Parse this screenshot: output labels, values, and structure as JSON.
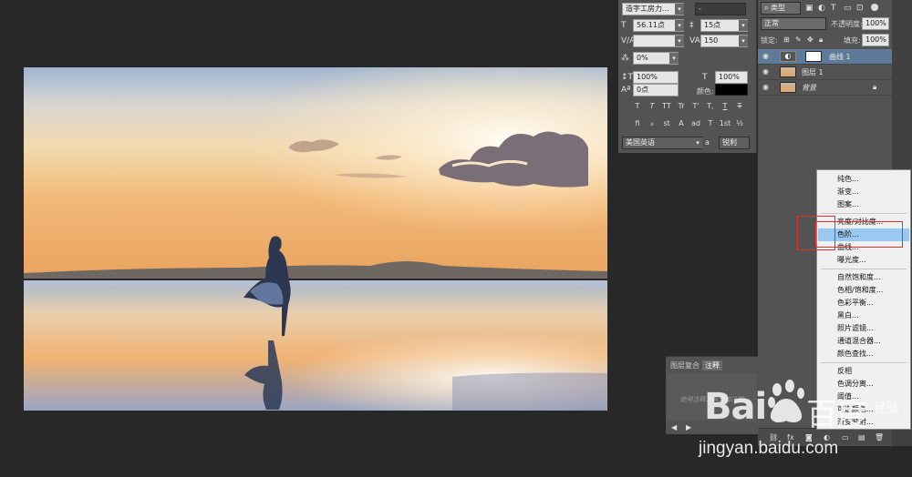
{
  "character_panel": {
    "font_family": "造字工房力...",
    "font_style": "-",
    "font_size": "56.11点",
    "leading": "15点",
    "kerning": "",
    "tracking": "150",
    "scale_percent": "0%",
    "vertical_scale": "100%",
    "horizontal_scale": "100%",
    "baseline_shift": "0点",
    "color_label": "颜色:",
    "style_glyphs": [
      "T",
      "T",
      "TT",
      "Tr",
      "T'",
      "T,",
      "T",
      "T"
    ],
    "opentype_glyphs": [
      "fi",
      "ℴ",
      "st",
      "A",
      "ad",
      "T",
      "1st",
      "½"
    ],
    "language": "美国英语",
    "aa_icon": "a",
    "antialias": "锐利"
  },
  "layers_panel": {
    "filter_kind": "类型",
    "filter_icons": [
      "image-filter-icon",
      "adjustment-filter-icon",
      "type-filter-icon",
      "shape-filter-icon",
      "smart-filter-icon"
    ],
    "blend_mode": "正常",
    "opacity_label": "不透明度:",
    "opacity_value": "100%",
    "lock_label": "锁定:",
    "fill_label": "填充:",
    "fill_value": "100%",
    "layers": [
      {
        "name": "曲线 1",
        "type": "adjustment",
        "selected": true
      },
      {
        "name": "图层 1",
        "type": "pixel",
        "selected": false
      },
      {
        "name": "背景",
        "type": "background",
        "selected": false
      }
    ]
  },
  "notes_panel": {
    "tab_layer_comps": "图层复合",
    "tab_notes": "注释",
    "hint": "使用注释工具添加注释"
  },
  "adjustment_menu": {
    "items": [
      "纯色...",
      "渐变...",
      "图案...",
      "亮度/对比度...",
      "色阶...",
      "曲线...",
      "曝光度...",
      "自然饱和度...",
      "色相/饱和度...",
      "色彩平衡...",
      "黑白...",
      "照片滤镜...",
      "通道混合器...",
      "颜色查找...",
      "反相",
      "色调分离...",
      "阈值...",
      "可选颜色...",
      "渐变映射..."
    ],
    "highlighted": "色阶..."
  },
  "watermark": {
    "brand_left": "Bai",
    "brand_right": "百度",
    "sub": "经验",
    "url": "jingyan.baidu.com"
  },
  "colors": {
    "accent_highlight": "#99c9f2",
    "selected_layer": "#5e7a99",
    "red_annotation": "#e23030"
  }
}
